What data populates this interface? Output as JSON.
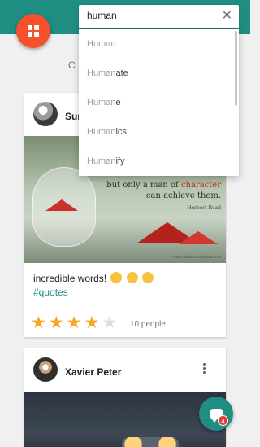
{
  "search": {
    "value": "human",
    "clear_icon": "close-icon",
    "suggestions": [
      {
        "match": "Human",
        "rest": ""
      },
      {
        "match": "Human",
        "rest": "ate"
      },
      {
        "match": "Human",
        "rest": "e"
      },
      {
        "match": "Human",
        "rest": "ics"
      },
      {
        "match": "Human",
        "rest": "ify"
      }
    ]
  },
  "colors": {
    "primary": "#1f8d82",
    "accent": "#f4512c",
    "star": "#f4a623"
  },
  "feed": {
    "posts": [
      {
        "user_name": "Sur",
        "image": {
          "quote_line1": "but only a man of ",
          "quote_highlight": "character",
          "quote_line2": "can achieve them.",
          "quote_author": "- Herbert Read",
          "watermark": "www.wisdomthoughts.com"
        },
        "caption": "incredible words!",
        "hashtag": "#quotes",
        "rating": 4,
        "rating_max": 5,
        "people": "10 people"
      },
      {
        "user_name": "Xavier Peter"
      }
    ]
  },
  "chat": {
    "badge": "4"
  }
}
